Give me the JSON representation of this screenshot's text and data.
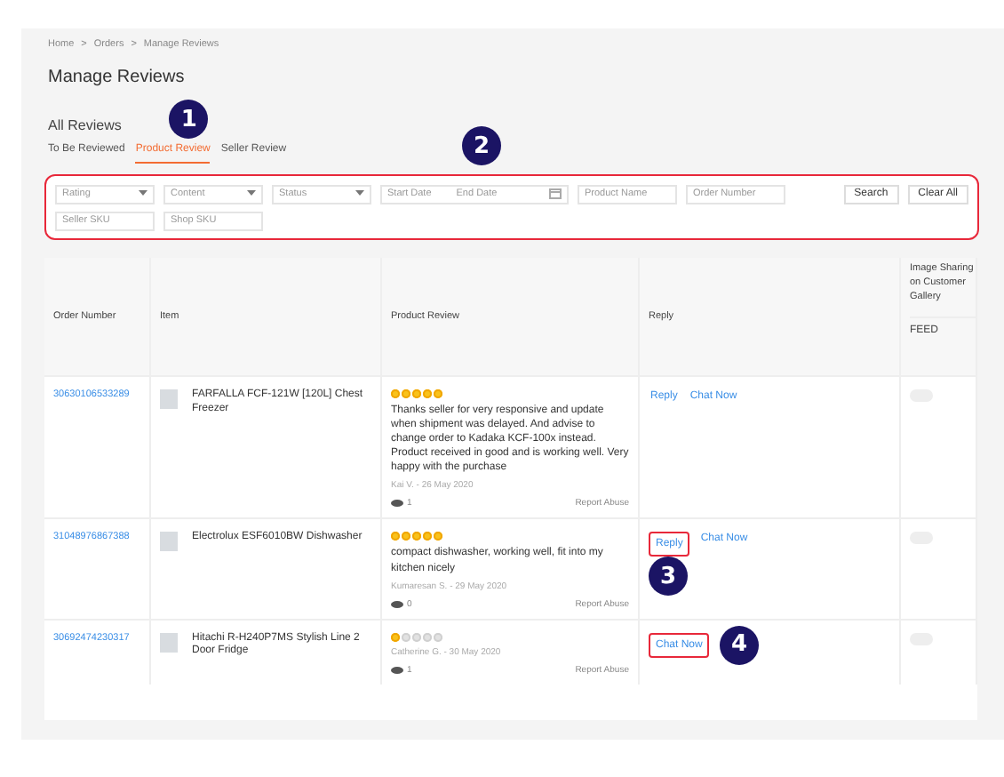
{
  "breadcrumb": [
    "Home",
    "Orders",
    "Manage Reviews"
  ],
  "breadcrumb_separator": ">",
  "title": "Manage Reviews",
  "section_title": "All Reviews",
  "tabs": [
    {
      "label": "To Be Reviewed",
      "selected": false
    },
    {
      "label": "Product Review",
      "selected": true,
      "callout": "1"
    },
    {
      "label": "Seller Review",
      "selected": false
    }
  ],
  "filters": {
    "callout": "2",
    "highlighted": true,
    "fields": [
      {
        "kind": "select",
        "placeholder": "Rating"
      },
      {
        "kind": "select",
        "placeholder": "Content"
      },
      {
        "kind": "select",
        "placeholder": "Status"
      },
      {
        "kind": "daterange",
        "placeholder": "Start Date",
        "placeholder_end": "End Date"
      },
      {
        "kind": "text",
        "placeholder": "Product Name"
      },
      {
        "kind": "text",
        "placeholder": "Order Number"
      },
      {
        "kind": "text",
        "placeholder": "Seller SKU"
      },
      {
        "kind": "text",
        "placeholder": "Shop SKU"
      }
    ],
    "buttons": [
      "Search",
      "Clear All"
    ]
  },
  "table": {
    "columns": [
      "Order Number",
      "Item",
      "Product Review",
      "Reply",
      "Image Sharing on Customer Gallery"
    ],
    "sub_column": "FEED",
    "rows": [
      {
        "order": "30630106533289",
        "item": "FARFALLA FCF-121W [120L] Chest Freezer",
        "stars": 5,
        "review": "Thanks seller for very responsive and update when shipment was delayed. And advise to change order to Kadaka KCF-100x instead. Product received in good and is working well. Very happy with the purchase",
        "reviewer": "Kai V. - 26 May 2020",
        "views": "1",
        "report": "Report Abuse",
        "actions": [
          {
            "label": "Reply",
            "highlighted": false
          },
          {
            "label": "Chat Now",
            "highlighted": false
          }
        ],
        "feed_on": false
      },
      {
        "order": "31048976867388",
        "item": "Electrolux ESF6010BW Dishwasher",
        "stars": 5,
        "review": "compact dishwasher, working well, fit into my kitchen nicely",
        "reviewer": "Kumaresan S. - 29 May 2020",
        "views": "0",
        "report": "Report Abuse",
        "actions": [
          {
            "label": "Reply",
            "highlighted": true,
            "callout": "3"
          },
          {
            "label": "Chat Now",
            "highlighted": false
          }
        ],
        "feed_on": false
      },
      {
        "order": "30692474230317",
        "item": "Hitachi R-H240P7MS Stylish Line 2 Door Fridge",
        "stars": 1,
        "reviewer": "Catherine G. - 30 May 2020",
        "views": "1",
        "report": "Report Abuse",
        "actions": [
          {
            "label": "Chat Now",
            "highlighted": true,
            "callout": "4"
          }
        ],
        "feed_on": false
      }
    ]
  }
}
